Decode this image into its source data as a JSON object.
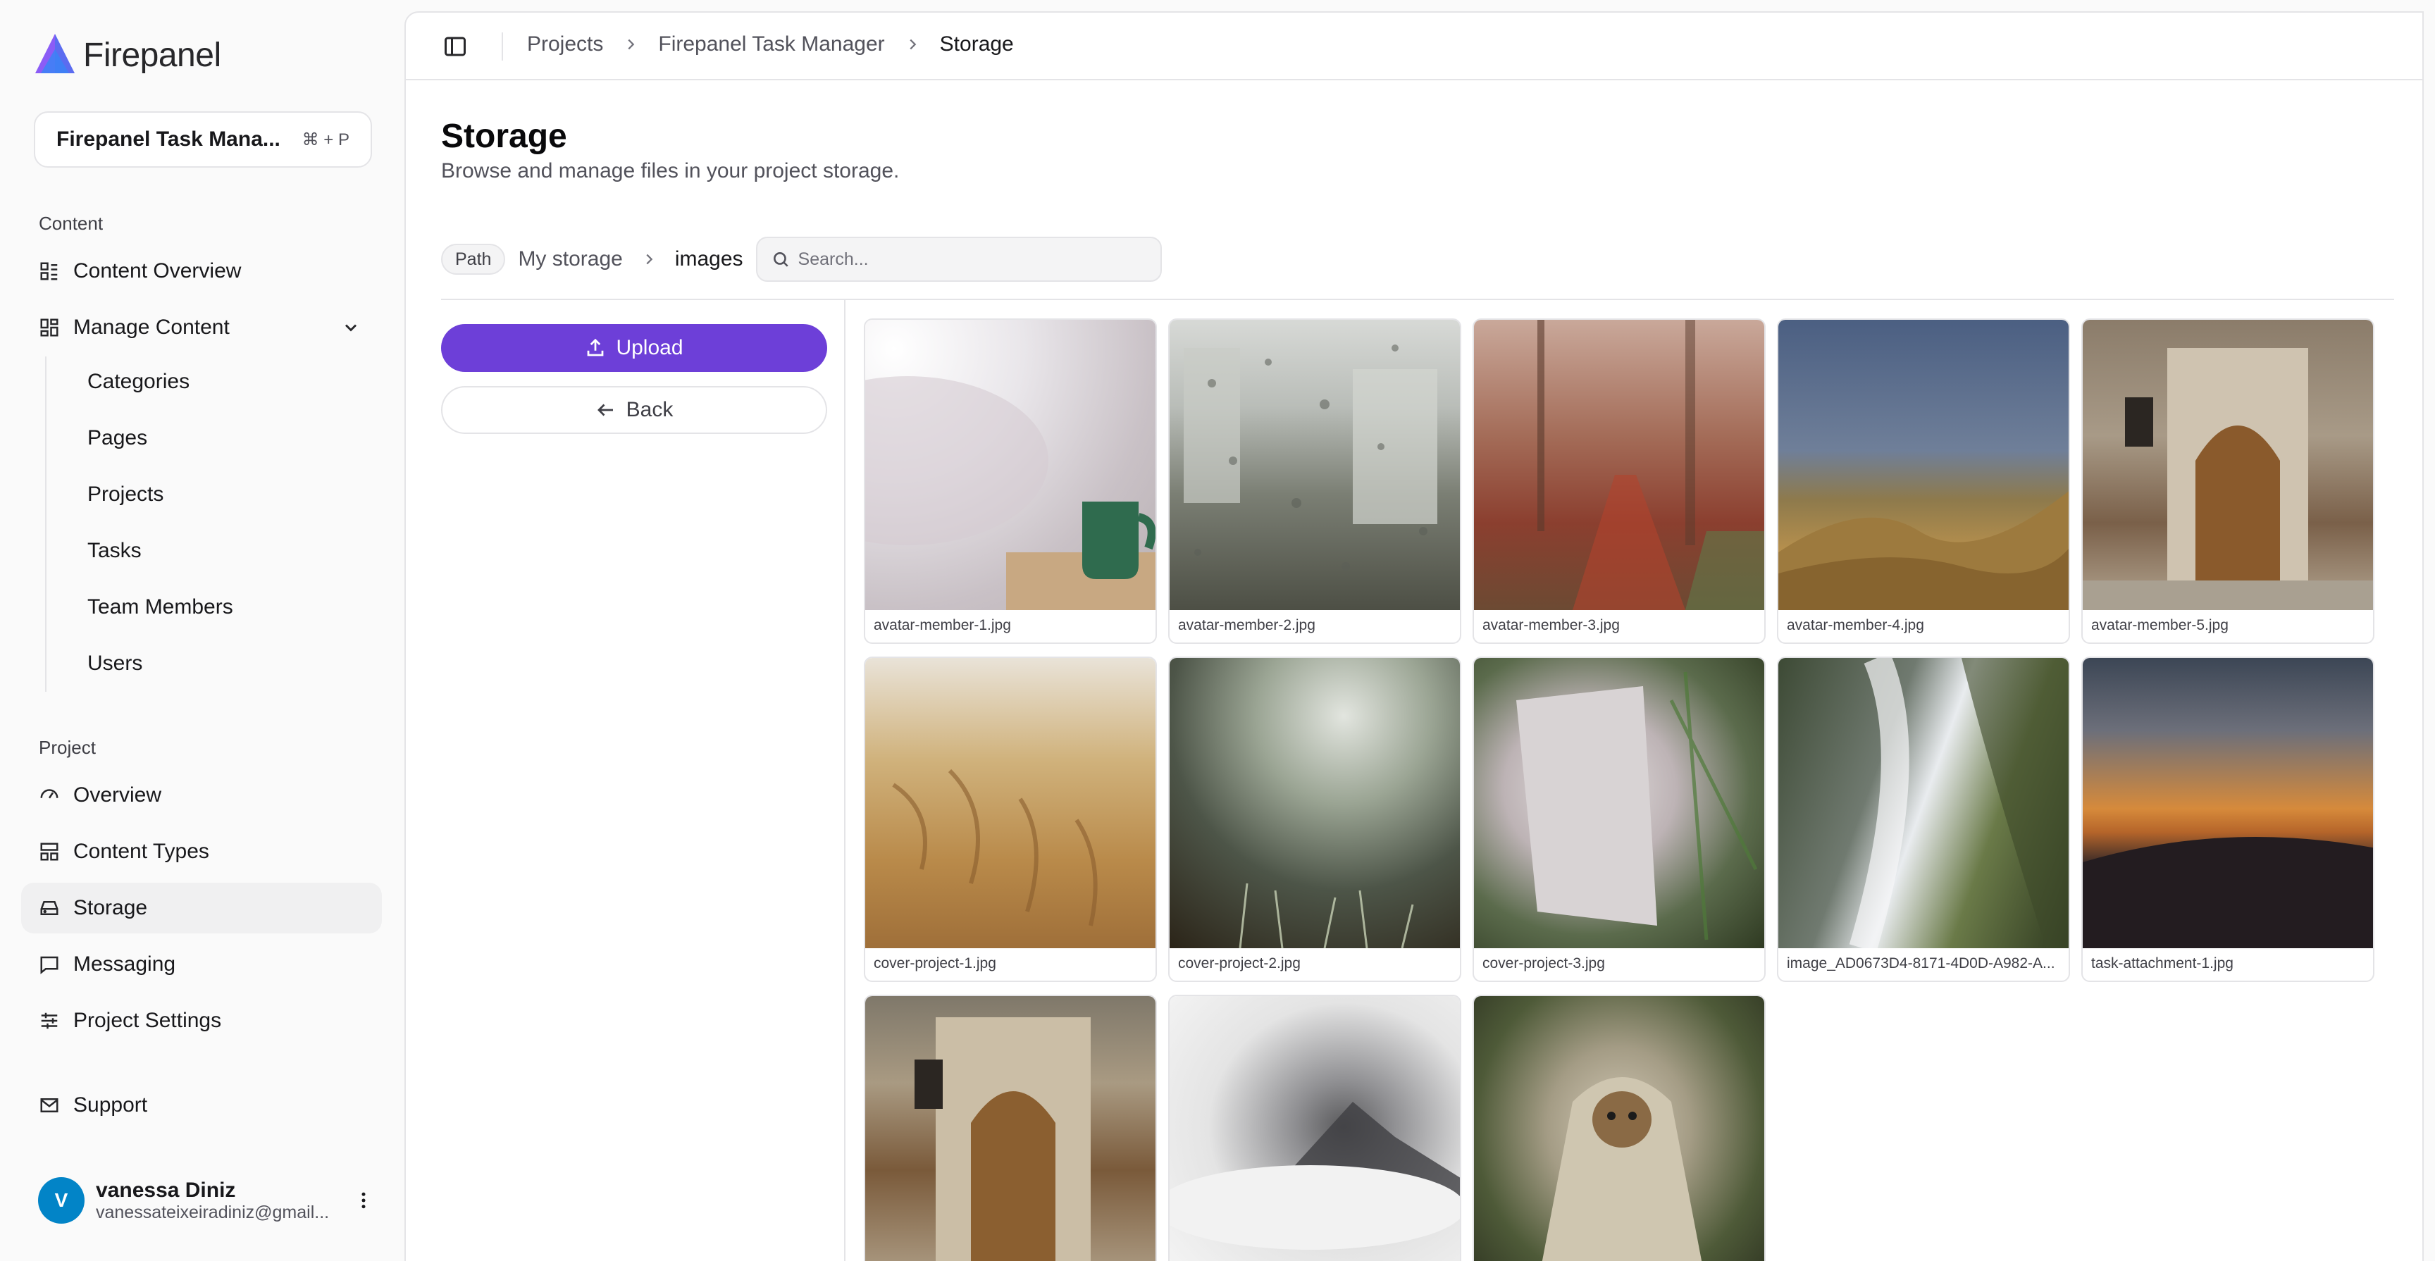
{
  "app": {
    "name": "Firepanel"
  },
  "project_switcher": {
    "name": "Firepanel Task Mana...",
    "shortcut": "⌘ + P"
  },
  "sidebar": {
    "content_label": "Content",
    "content_items": [
      {
        "label": "Content Overview",
        "icon": "list-grid-icon"
      },
      {
        "label": "Manage Content",
        "icon": "layout-grid-icon"
      }
    ],
    "manage_sub_items": [
      "Categories",
      "Pages",
      "Projects",
      "Tasks",
      "Team Members",
      "Users"
    ],
    "project_label": "Project",
    "project_items": [
      {
        "label": "Overview",
        "icon": "gauge-icon"
      },
      {
        "label": "Content Types",
        "icon": "layout-icon"
      },
      {
        "label": "Storage",
        "icon": "hard-drive-icon",
        "active": true
      },
      {
        "label": "Messaging",
        "icon": "message-square-icon"
      },
      {
        "label": "Project Settings",
        "icon": "sliders-icon"
      }
    ],
    "support": {
      "label": "Support",
      "icon": "mail-icon"
    }
  },
  "user": {
    "initial": "V",
    "name": "vanessa Diniz",
    "email": "vanessateixeiradiniz@gmail..."
  },
  "breadcrumb": [
    "Projects",
    "Firepanel Task Manager",
    "Storage"
  ],
  "page": {
    "title": "Storage",
    "subtitle": "Browse and manage files in your project storage."
  },
  "path": {
    "badge": "Path",
    "segments": [
      "My storage",
      "images"
    ],
    "search_placeholder": "Search..."
  },
  "actions": {
    "upload": "Upload",
    "back": "Back"
  },
  "files": [
    {
      "name": "avatar-member-1.jpg"
    },
    {
      "name": "avatar-member-2.jpg"
    },
    {
      "name": "avatar-member-3.jpg"
    },
    {
      "name": "avatar-member-4.jpg"
    },
    {
      "name": "avatar-member-5.jpg"
    },
    {
      "name": "cover-project-1.jpg"
    },
    {
      "name": "cover-project-2.jpg"
    },
    {
      "name": "cover-project-3.jpg"
    },
    {
      "name": "image_AD0673D4-8171-4D0D-A982-A..."
    },
    {
      "name": "task-attachment-1.jpg"
    },
    {
      "name": ""
    },
    {
      "name": ""
    },
    {
      "name": ""
    }
  ],
  "colors": {
    "accent": "#6d3fd8",
    "avatar": "#0284c7"
  }
}
